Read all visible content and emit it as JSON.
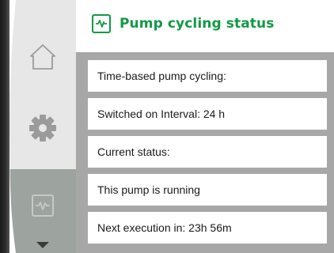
{
  "header": {
    "title": "Pump cycling status",
    "icon": "activity-pulse-icon",
    "accent_color": "#119a45"
  },
  "sidebar": {
    "items": [
      {
        "icon": "home-icon",
        "selected": false
      },
      {
        "icon": "gear-icon",
        "selected": false
      },
      {
        "icon": "activity-pulse-icon",
        "selected": true
      }
    ],
    "scroll_indicator": "chevron-down-icon"
  },
  "status_rows": [
    {
      "text": "Time-based pump cycling:"
    },
    {
      "text": "Switched on Interval: 24 h"
    },
    {
      "text": "Current status:"
    },
    {
      "text": "This pump is running"
    },
    {
      "text": "Next execution in: 23h 56m"
    }
  ],
  "colors": {
    "content_background": "#a7a7a7",
    "sidebar_background": "#e7e7e7",
    "sidebar_selected": "#9da39f"
  }
}
